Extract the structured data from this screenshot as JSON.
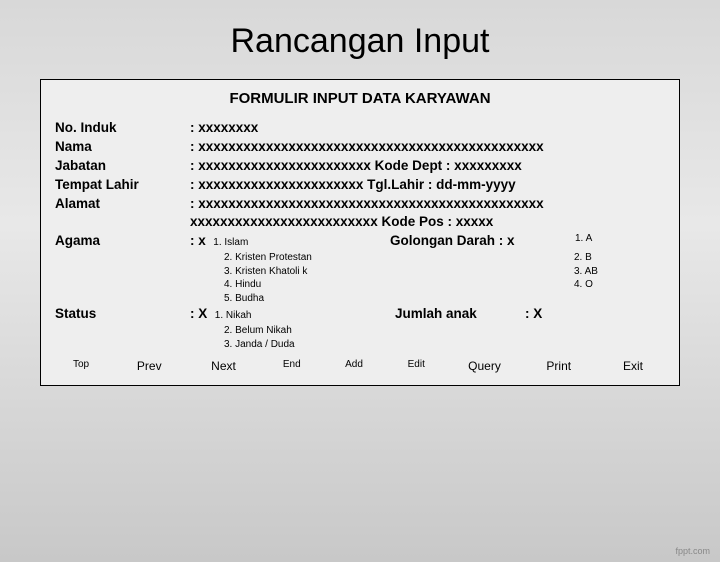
{
  "title": "Rancangan Input",
  "form_title": "FORMULIR INPUT DATA KARYAWAN",
  "fields": {
    "no_induk": {
      "label": "No. Induk",
      "value": ": xxxxxxxx"
    },
    "nama": {
      "label": "Nama",
      "value": ": xxxxxxxxxxxxxxxxxxxxxxxxxxxxxxxxxxxxxxxxxxxxxx"
    },
    "jabatan": {
      "label": "Jabatan",
      "value": ": xxxxxxxxxxxxxxxxxxxxxxx  Kode Dept : xxxxxxxxx"
    },
    "tempat": {
      "label": "Tempat Lahir",
      "value": ": xxxxxxxxxxxxxxxxxxxxxx  Tgl.Lahir    : dd-mm-yyyy"
    },
    "alamat": {
      "label": "Alamat",
      "value": ": xxxxxxxxxxxxxxxxxxxxxxxxxxxxxxxxxxxxxxxxxxxxxx"
    },
    "alamat2": "xxxxxxxxxxxxxxxxxxxxxxxxx Kode Pos  : xxxxx",
    "agama": {
      "label": "Agama",
      "value": ": x"
    },
    "agama_gol": "Golongan Darah  : x",
    "agama_a": "1.   A",
    "agama_opts": [
      "1. Islam",
      "2. Kristen Protestan",
      "3. Kristen Khatoli k",
      "4. Hindu",
      "5. Budha"
    ],
    "darah_opts": [
      "2.  B",
      "3. AB",
      "4.  O"
    ],
    "status": {
      "label": "Status",
      "value": ": X"
    },
    "status_j": "Jumlah anak",
    "status_x": ": X",
    "status_opts": [
      "1. Nikah",
      "2. Belum Nikah",
      "3. Janda / Duda"
    ]
  },
  "buttons": {
    "top": "Top",
    "prev": "Prev",
    "next": "Next",
    "end": "End",
    "add": "Add",
    "edit": "Edit",
    "query": "Query",
    "print": "Print",
    "exit": "Exit"
  },
  "footer": "fppt.com"
}
